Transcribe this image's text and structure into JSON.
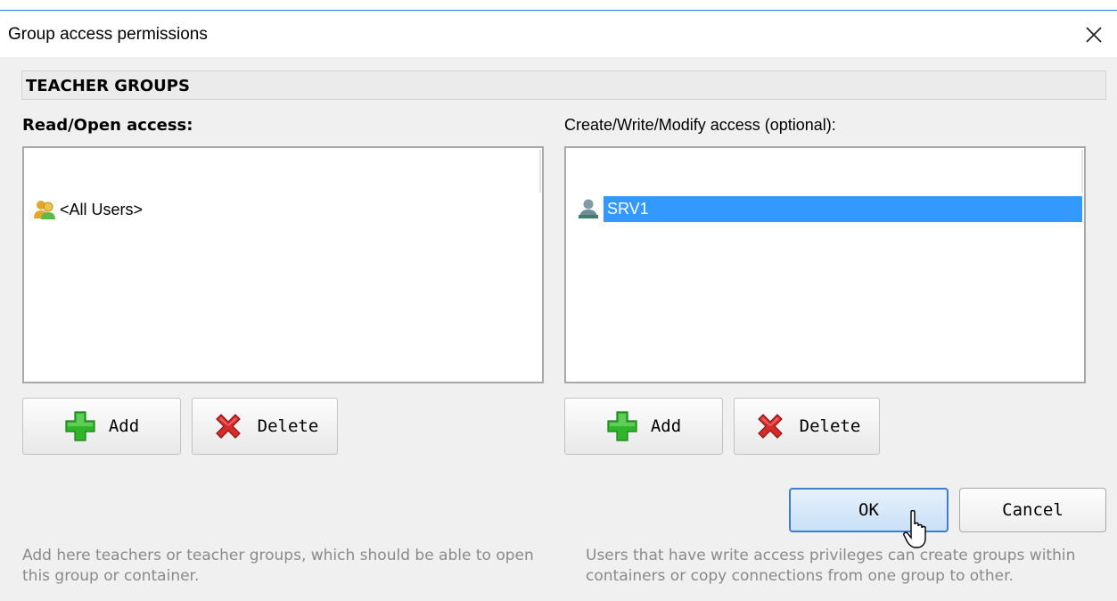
{
  "window": {
    "title": "Group access permissions",
    "close_glyph": "✕"
  },
  "section": {
    "header": "TEACHER GROUPS"
  },
  "read_access": {
    "label": "Read/Open access:",
    "items": [
      {
        "label": "<All Users>",
        "icon": "user-group-icon",
        "selected": false
      }
    ],
    "add_label": "Add",
    "delete_label": "Delete"
  },
  "write_access": {
    "label": "Create/Write/Modify access (optional):",
    "items": [
      {
        "label": "SRV1",
        "icon": "computer-user-icon",
        "selected": true
      }
    ],
    "add_label": "Add",
    "delete_label": "Delete"
  },
  "footer": {
    "ok_label": "OK",
    "cancel_label": "Cancel"
  },
  "hints": {
    "left": "Add here teachers or teacher groups, which should be able to open this group or container.",
    "right": "Users that have write access privileges can create groups within containers or copy connections from one group to other."
  },
  "colors": {
    "selection": "#3399ff",
    "ok_border": "#3c7fd1",
    "add_green": "#2fb52a",
    "delete_red": "#d42b2b"
  }
}
